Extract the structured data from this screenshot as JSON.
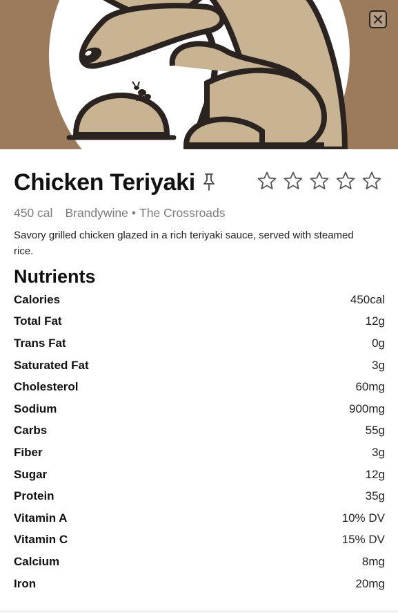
{
  "item": {
    "title": "Chicken Teriyaki",
    "calories_label": "450 cal",
    "dining_hall": "Brandywine",
    "station": "The Crossroads",
    "separator": "•",
    "description": "Savory grilled chicken glazed in a rich teriyaki sauce, served with steamed rice.",
    "rating": {
      "filled": 0,
      "max": 5
    }
  },
  "nutrients": {
    "heading": "Nutrients",
    "rows": [
      {
        "label": "Calories",
        "value": "450cal"
      },
      {
        "label": "Total Fat",
        "value": "12g"
      },
      {
        "label": "Trans Fat",
        "value": "0g"
      },
      {
        "label": "Saturated Fat",
        "value": "3g"
      },
      {
        "label": "Cholesterol",
        "value": "60mg"
      },
      {
        "label": "Sodium",
        "value": "900mg"
      },
      {
        "label": "Carbs",
        "value": "55g"
      },
      {
        "label": "Fiber",
        "value": "3g"
      },
      {
        "label": "Sugar",
        "value": "12g"
      },
      {
        "label": "Protein",
        "value": "35g"
      },
      {
        "label": "Vitamin A",
        "value": "10% DV"
      },
      {
        "label": "Vitamin C",
        "value": "15% DV"
      },
      {
        "label": "Calcium",
        "value": "8mg"
      },
      {
        "label": "Iron",
        "value": "20mg"
      }
    ]
  },
  "icons": {
    "close": "close-icon",
    "pin": "pin-icon",
    "star": "star-outline-icon"
  },
  "colors": {
    "hero_background": "#9c7b5c",
    "mascot_tan": "#c8b393",
    "outline": "#2b2320",
    "meta_gray": "#7c7c7c"
  }
}
